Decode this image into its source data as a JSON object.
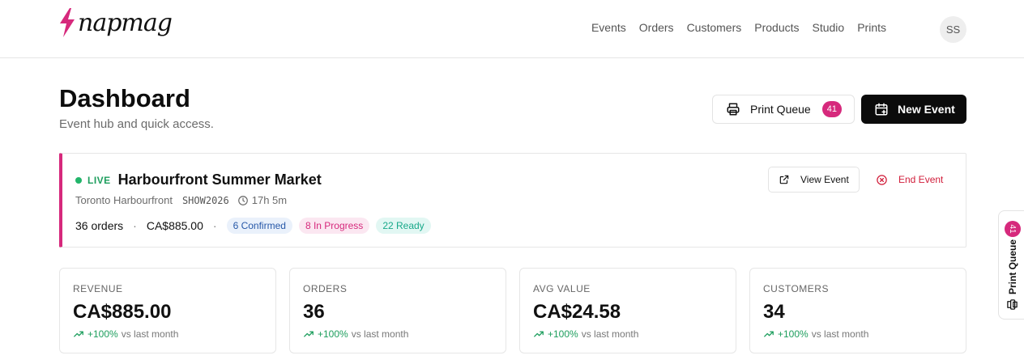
{
  "brand": {
    "logo_text": "napmag"
  },
  "nav": {
    "items": [
      "Events",
      "Orders",
      "Customers",
      "Products",
      "Studio",
      "Prints"
    ],
    "avatar_initials": "SS"
  },
  "page": {
    "title": "Dashboard",
    "subtitle": "Event hub and quick access."
  },
  "actions": {
    "print_queue_label": "Print Queue",
    "print_queue_count": "41",
    "new_event_label": "New Event"
  },
  "live_event": {
    "status": "LIVE",
    "name": "Harbourfront Summer Market",
    "location": "Toronto Harbourfront",
    "code": "SHOW2026",
    "duration": "17h 5m",
    "orders": "36 orders",
    "revenue": "CA$885.00",
    "chips": {
      "confirmed": "6 Confirmed",
      "in_progress": "8 In Progress",
      "ready": "22 Ready"
    },
    "view_label": "View Event",
    "end_label": "End Event"
  },
  "kpis": [
    {
      "label": "REVENUE",
      "value": "CA$885.00",
      "delta": "+100%",
      "delta_suffix": "vs last month"
    },
    {
      "label": "ORDERS",
      "value": "36",
      "delta": "+100%",
      "delta_suffix": "vs last month"
    },
    {
      "label": "AVG VALUE",
      "value": "CA$24.58",
      "delta": "+100%",
      "delta_suffix": "vs last month"
    },
    {
      "label": "CUSTOMERS",
      "value": "34",
      "delta": "+100%",
      "delta_suffix": "vs last month"
    }
  ],
  "side_tab": {
    "label": "Print Queue",
    "count": "41"
  },
  "colors": {
    "accent": "#d6297c",
    "live_green": "#1d9e5d",
    "danger": "#d11d3a",
    "primary_button": "#0b0b0b"
  },
  "icons": [
    "bolt-logo-icon",
    "printer-icon",
    "calendar-plus-icon",
    "external-link-icon",
    "x-circle-icon",
    "clock-icon",
    "trending-up-icon"
  ]
}
